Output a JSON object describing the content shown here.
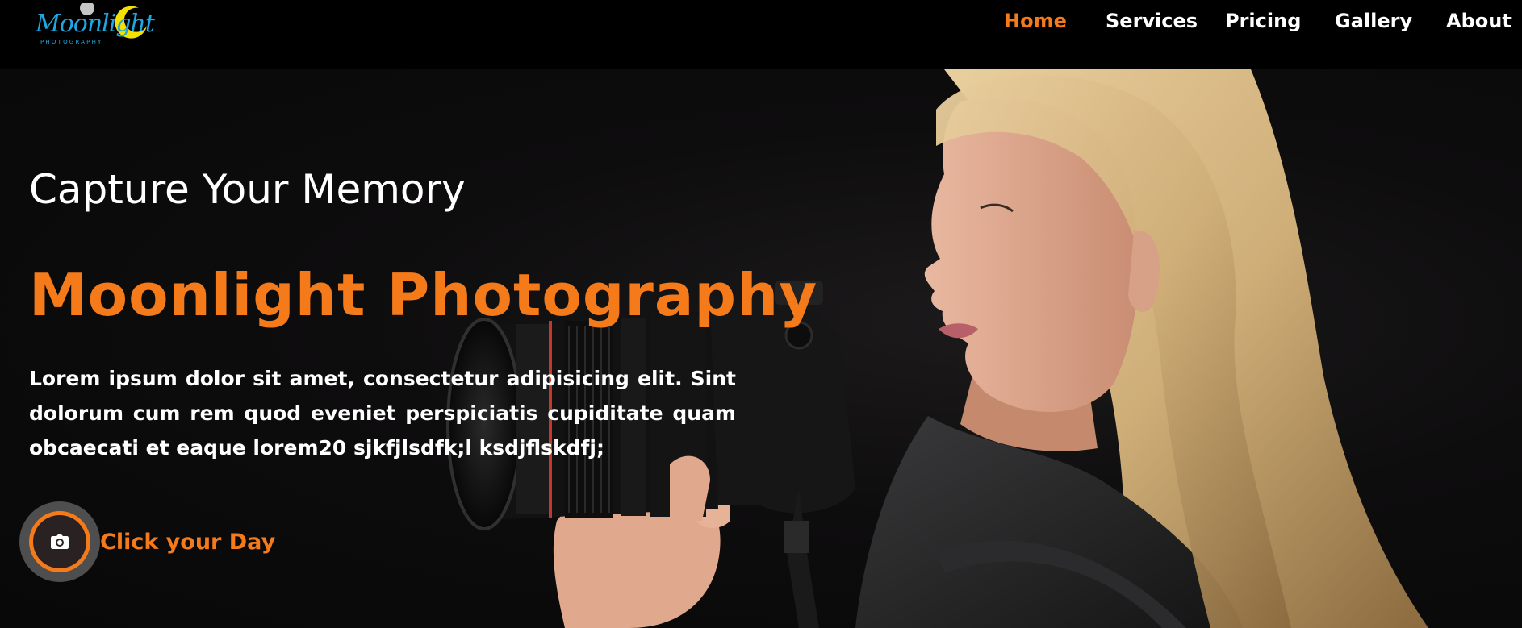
{
  "brand": {
    "logo_word": "Moonlight",
    "logo_sub": "PHOTOGRAPHY"
  },
  "nav": {
    "items": [
      {
        "label": "Home",
        "active": true
      },
      {
        "label": "Services",
        "active": false
      },
      {
        "label": "Pricing",
        "active": false
      },
      {
        "label": "Gallery",
        "active": false
      },
      {
        "label": "About",
        "active": false
      }
    ]
  },
  "hero": {
    "subtitle": "Capture Your Memory",
    "title": "Moonlight Photography",
    "text": "Lorem ipsum dolor sit amet, consectetur adipisicing elit. Sint dolorum cum rem quod eveniet perspiciatis cupiditate quam obcaecati et eaque lorem20 sjkfjlsdfk;l ksdjflskdfj;",
    "cta_label": "Click your Day",
    "cta_icon": "camera-icon"
  },
  "colors": {
    "accent": "#f57a1a",
    "background": "#000000",
    "text": "#ffffff",
    "logo": "#1ea7e0",
    "logo_moon": "#f5e100"
  }
}
